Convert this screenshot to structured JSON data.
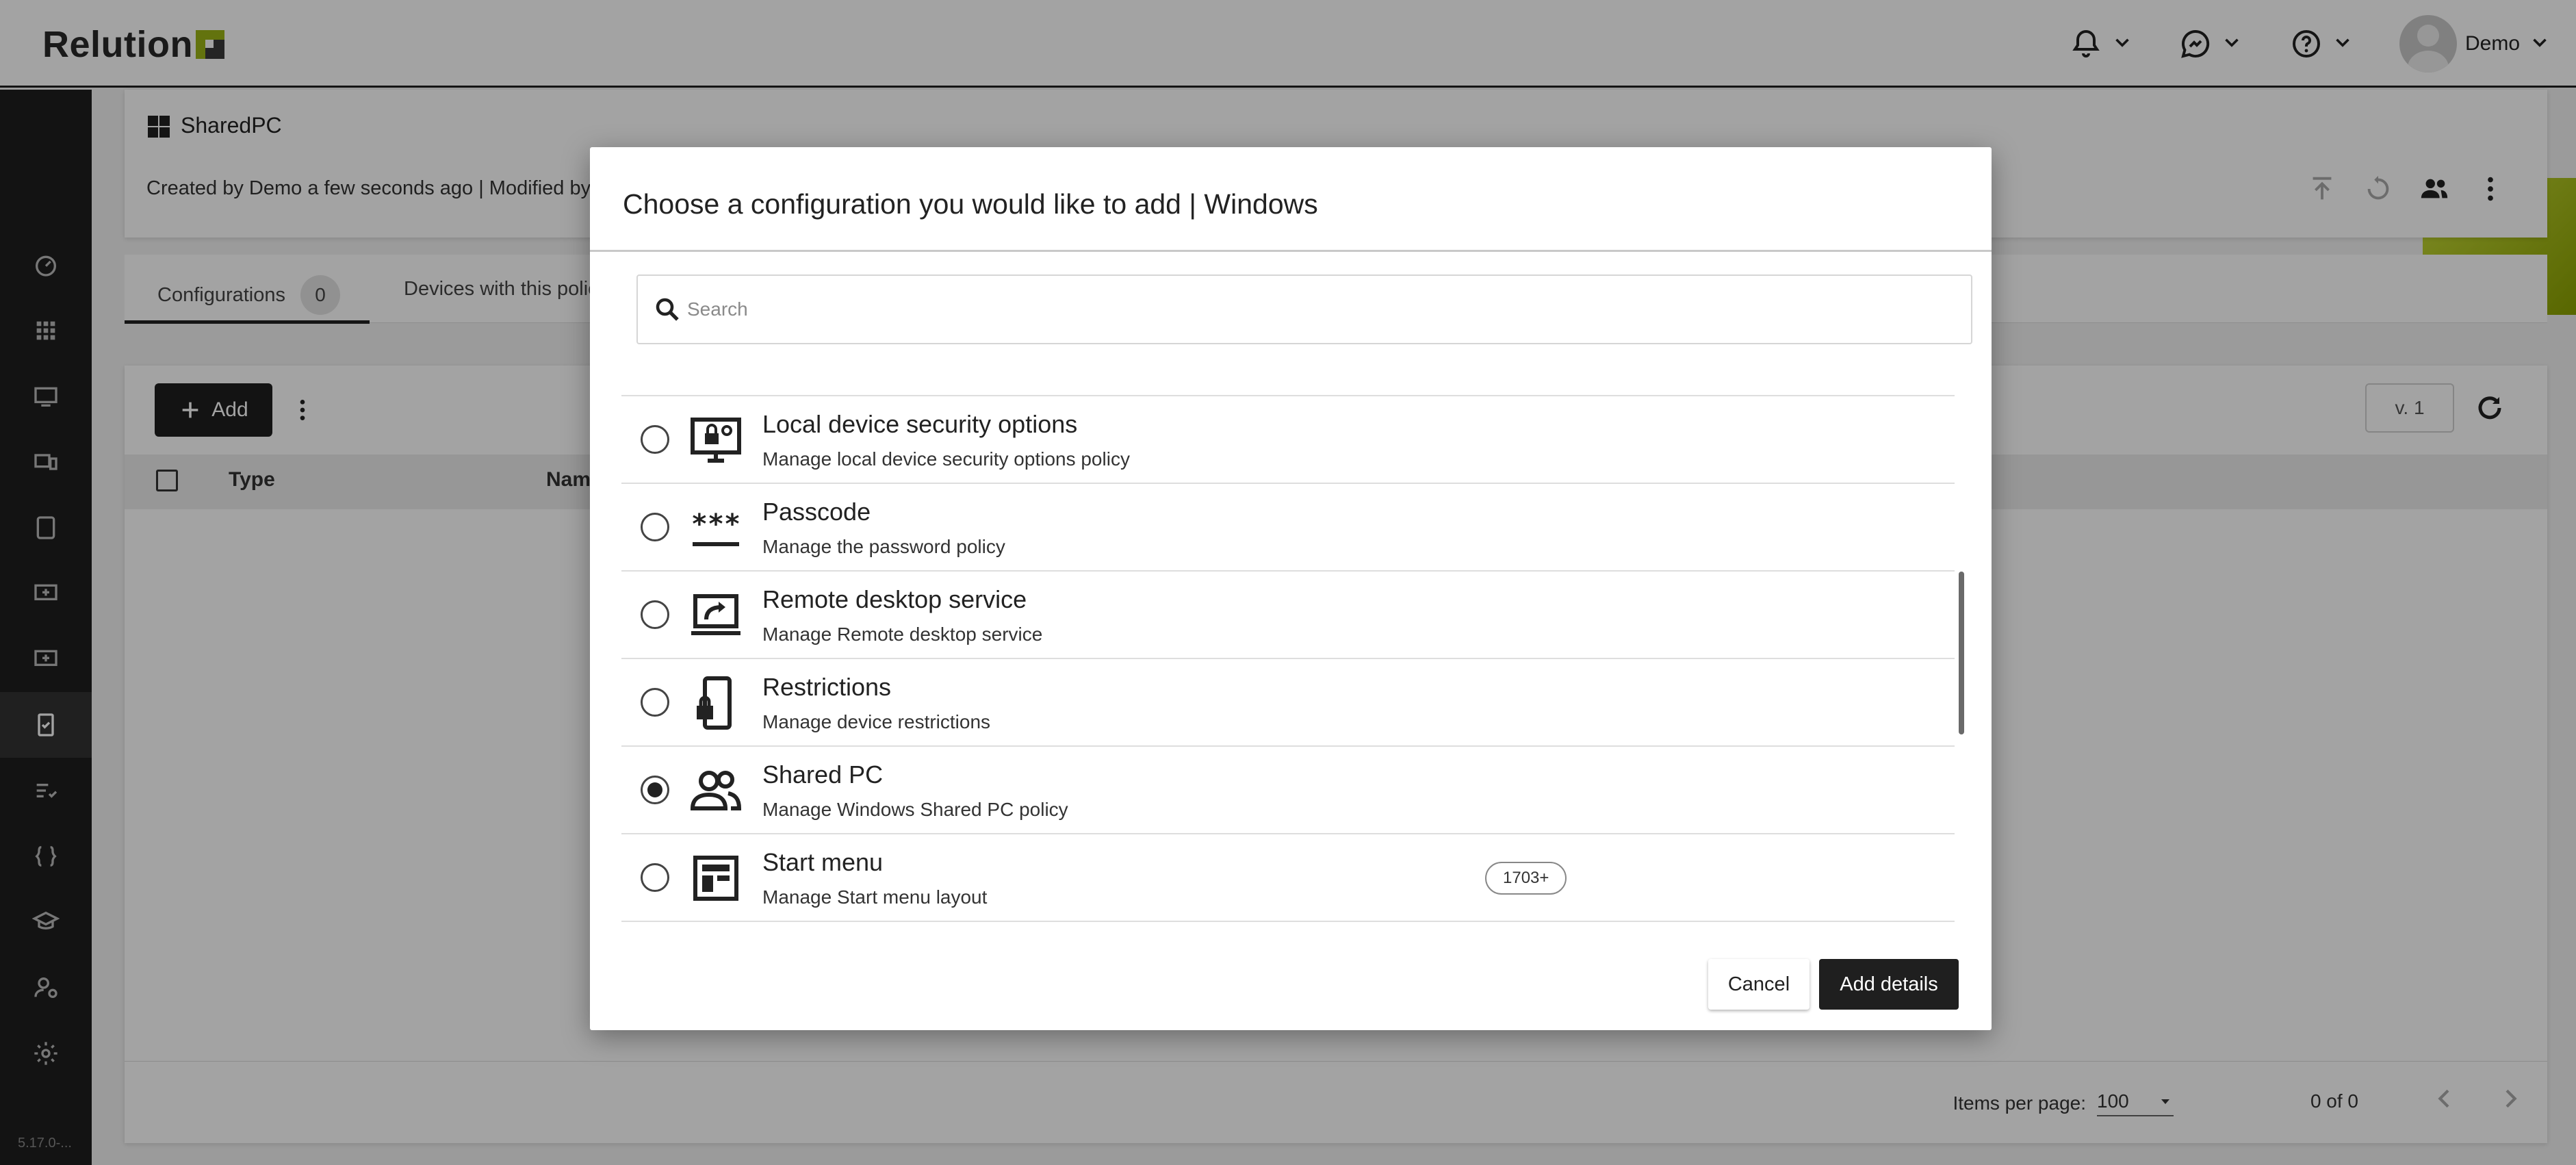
{
  "app": {
    "logo_text": "Relution",
    "version": "5.17.0-...",
    "user_name": "Demo",
    "colors": {
      "accent": "#9bb516",
      "dark": "#1f1f1f"
    }
  },
  "policy": {
    "name": "SharedPC",
    "created_info": "Created by Demo a few seconds ago  |  Modified by"
  },
  "tabs": [
    {
      "label": "Configurations",
      "count": "0"
    },
    {
      "label": "Devices with this policy"
    }
  ],
  "toolbar": {
    "add_label": "Add",
    "version_label": "v. 1"
  },
  "table": {
    "columns": [
      "Type",
      "Name"
    ]
  },
  "footer": {
    "items_per_page_label": "Items per page:",
    "items_per_page_value": "100",
    "range": "0 of 0"
  },
  "modal": {
    "title": "Choose a configuration you would like to add | Windows",
    "search_placeholder": "Search",
    "items": [
      {
        "title": "Local device security options",
        "description": "Manage local device security options policy",
        "icon": "monitor-lock-icon",
        "selected": false
      },
      {
        "title": "Passcode",
        "description": "Manage the password policy",
        "icon": "password-icon",
        "selected": false
      },
      {
        "title": "Remote desktop service",
        "description": "Manage Remote desktop service",
        "icon": "remote-desktop-icon",
        "selected": false
      },
      {
        "title": "Restrictions",
        "description": "Manage device restrictions",
        "icon": "phone-lock-icon",
        "selected": false
      },
      {
        "title": "Shared PC",
        "description": "Manage Windows Shared PC policy",
        "icon": "people-icon",
        "selected": true
      },
      {
        "title": "Start menu",
        "description": "Manage Start menu layout",
        "icon": "start-menu-icon",
        "selected": false,
        "version_chip": "1703+"
      }
    ],
    "cancel_label": "Cancel",
    "confirm_label": "Add details"
  }
}
